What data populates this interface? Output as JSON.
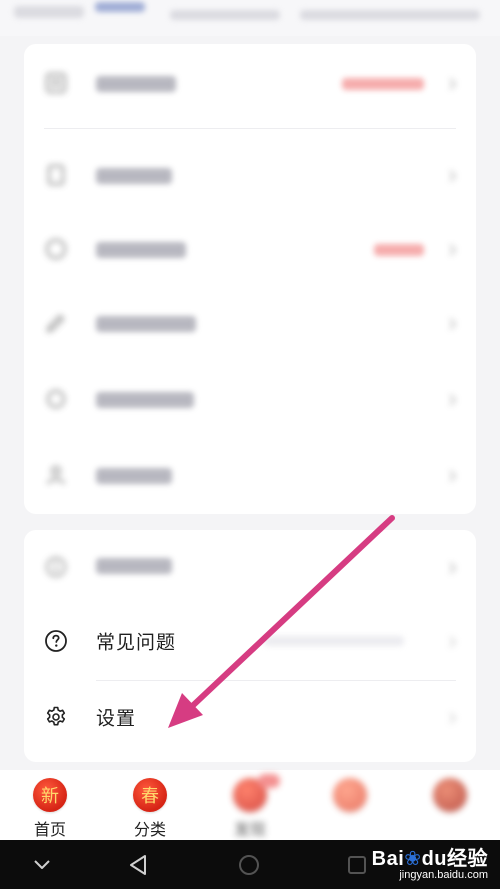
{
  "menu": {
    "faq_label": "常见问题",
    "settings_label": "设置"
  },
  "tabbar": {
    "tabs": [
      {
        "icon_char": "新",
        "label": "首页"
      },
      {
        "icon_char": "春",
        "label": "分类"
      },
      {
        "icon_char": "",
        "label": "发现"
      },
      {
        "icon_char": "",
        "label": ""
      },
      {
        "icon_char": "",
        "label": ""
      }
    ]
  },
  "watermark": {
    "logo": "Bai",
    "logo_mid": "du",
    "logo_suffix": "经验",
    "url": "jingyan.baidu.com"
  },
  "colors": {
    "accent_arrow": "#d63c82",
    "badge_red": "#f04a4a",
    "tab_red": "#d62415"
  }
}
